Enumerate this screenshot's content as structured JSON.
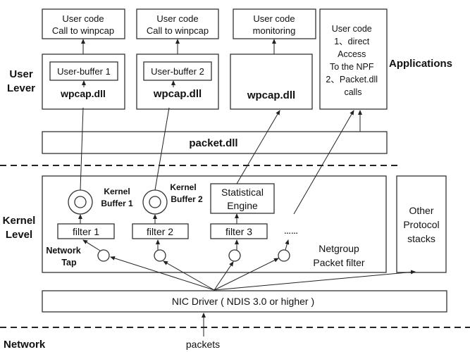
{
  "layers": {
    "user": [
      "User",
      "Lever"
    ],
    "kernel": [
      "Kernel",
      "Level"
    ],
    "network": "Network",
    "applications": "Applications"
  },
  "user_code": [
    [
      "User code",
      "Call to winpcap"
    ],
    [
      "User code",
      "Call to winpcap"
    ],
    [
      "User code",
      "monitoring"
    ],
    [
      "User code",
      "1、direct",
      "Access",
      "To the NPF",
      "2、Packet.dll",
      "calls"
    ]
  ],
  "user_buffers": [
    "User-buffer 1",
    "User-buffer 2"
  ],
  "wpcap": [
    "wpcap.dll",
    "wpcap.dll",
    "wpcap.dll"
  ],
  "packet_dll": "packet.dll",
  "kernel_buffers": [
    [
      "Kernel",
      "Buffer 1"
    ],
    [
      "Kernel",
      "Buffer 2"
    ]
  ],
  "statistical_engine": [
    "Statistical",
    "Engine"
  ],
  "filters": [
    "filter 1",
    "filter 2",
    "filter 3",
    "……"
  ],
  "network_tap": [
    "Network",
    "Tap"
  ],
  "npf": [
    "Netgroup",
    "Packet filter"
  ],
  "other_protocol": [
    "Other",
    "Protocol",
    "stacks"
  ],
  "nic_driver": "NIC Driver ( NDIS 3.0 or higher )",
  "packets": "packets"
}
